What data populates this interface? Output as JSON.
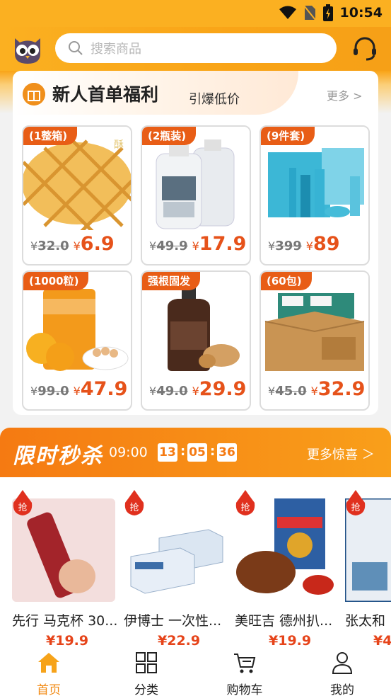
{
  "status_bar": {
    "time": "10:54"
  },
  "search": {
    "placeholder": "搜索商品"
  },
  "newcomer": {
    "title": "新人首单福利",
    "subtitle": "引爆低价",
    "more": "更多 >",
    "items": [
      {
        "tag": "(1整箱)",
        "old_price": "32.0",
        "new_price": "6.9"
      },
      {
        "tag": "(2瓶装)",
        "old_price": "49.9",
        "new_price": "17.9"
      },
      {
        "tag": "(9件套)",
        "old_price": "399",
        "new_price": "89"
      },
      {
        "tag": "(1000粒)",
        "old_price": "99.0",
        "new_price": "47.9"
      },
      {
        "tag": "强根固发",
        "old_price": "49.0",
        "new_price": "29.9"
      },
      {
        "tag": "(60包)",
        "old_price": "45.0",
        "new_price": "32.9"
      }
    ]
  },
  "flash_sale": {
    "title": "限时秒杀",
    "session": "09:00",
    "countdown": {
      "h": "13",
      "m": "05",
      "s": "36"
    },
    "more": "更多惊喜 ＞",
    "badge": "抢",
    "products": [
      {
        "name": "先行 马克杯 30...",
        "price": "¥19.9"
      },
      {
        "name": "伊博士 一次性...",
        "price": "¥22.9"
      },
      {
        "name": "美旺吉 德州扒...",
        "price": "¥19.9"
      },
      {
        "name": "张太和",
        "price": "¥4"
      }
    ]
  },
  "tabbar": [
    {
      "label": "首页",
      "icon": "home-icon"
    },
    {
      "label": "分类",
      "icon": "grid-icon"
    },
    {
      "label": "购物车",
      "icon": "cart-icon"
    },
    {
      "label": "我的",
      "icon": "user-icon"
    }
  ]
}
